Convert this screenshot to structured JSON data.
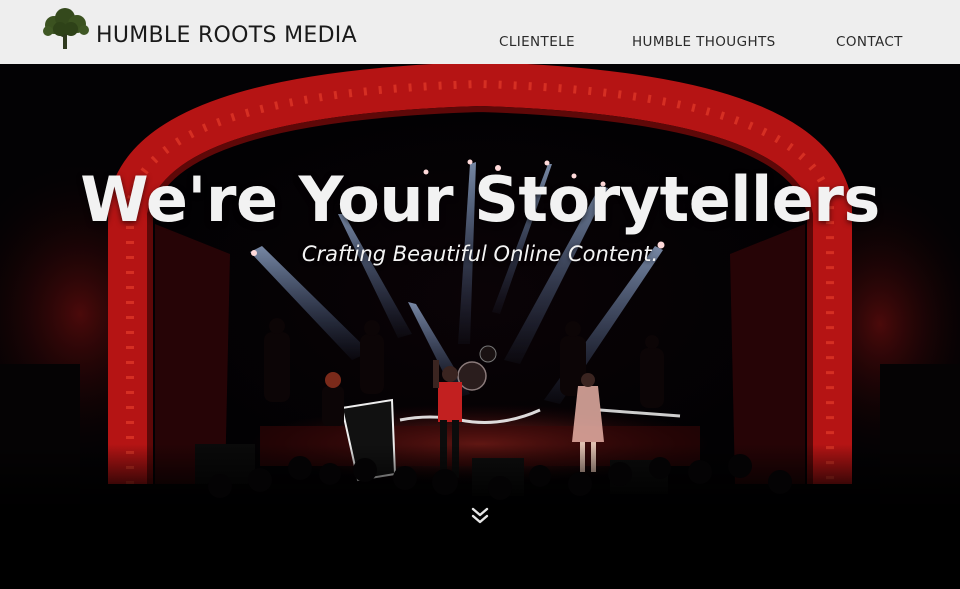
{
  "brand": {
    "name": "HUMBLE ROOTS MEDIA",
    "logo_icon": "tree-icon"
  },
  "nav": {
    "items": [
      {
        "label": "CLIENTELE"
      },
      {
        "label": "HUMBLE THOUGHTS"
      },
      {
        "label": "CONTACT"
      }
    ]
  },
  "hero": {
    "headline": "We're Your Storytellers",
    "tagline": "Crafting Beautiful Online Content.",
    "scroll_icon": "double-chevron-down-icon",
    "background_description_icon": "concert-stage-photo"
  },
  "colors": {
    "topbar_bg": "#eeeeee",
    "text_dark": "#1a1a1a",
    "stage_red": "#c41818",
    "hero_text": "#f2f2f2"
  }
}
